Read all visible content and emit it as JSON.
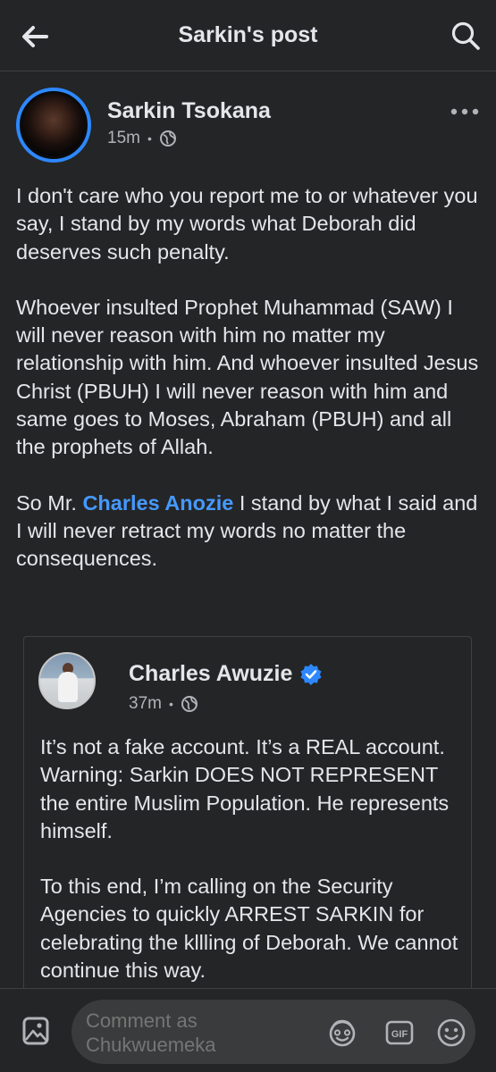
{
  "header": {
    "title": "Sarkin's post"
  },
  "post": {
    "author": "Sarkin Tsokana",
    "time": "15m",
    "separator": "•",
    "privacy_icon": "globe-icon",
    "paragraphs": [
      "I don't care who you report me to or whatever you say, I stand by my words what Deborah did deserves such penalty.",
      "Whoever insulted Prophet Muhammad (SAW) I will never reason with him no matter my relationship with him. And whoever insulted Jesus Christ (PBUH) I will never reason with him and same goes to Moses, Abraham (PBUH) and all the prophets of Allah."
    ],
    "p3_before": "So Mr. ",
    "mention": "Charles Anozie",
    "p3_after": " I stand by what I said and I will never retract my words no matter the consequences."
  },
  "shared_post": {
    "author": "Charles Awuzie",
    "verified_icon": "verified-badge-icon",
    "time": "37m",
    "separator": "•",
    "privacy_icon": "globe-icon",
    "paragraphs": [
      "It’s not a fake account. It’s a REAL account. Warning: Sarkin DOES NOT REPRESENT the entire Muslim Population. He represents himself.",
      "To this end, I’m calling on the Security Agencies to quickly ARREST SARKIN for celebrating the kllling of Deborah. We cannot continue this way."
    ]
  },
  "composer": {
    "placeholder": "Comment as Chukwuemeka",
    "gif_label": "GIF"
  },
  "colors": {
    "background": "#242526",
    "accent": "#2d88ff",
    "mention": "#4599ff"
  }
}
